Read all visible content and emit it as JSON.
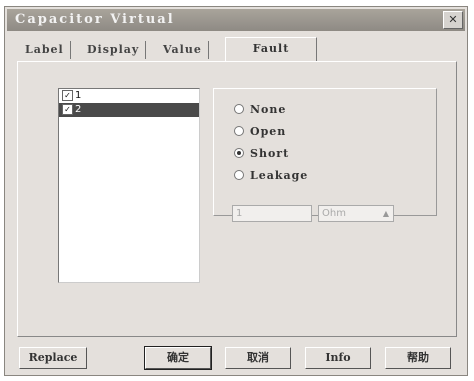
{
  "window": {
    "title": "Capacitor Virtual",
    "close_label": "✕"
  },
  "tabs": [
    {
      "label": "Label"
    },
    {
      "label": "Display"
    },
    {
      "label": "Value"
    },
    {
      "label": "Fault"
    }
  ],
  "fault_list": {
    "items": [
      {
        "label": "1",
        "checked": true,
        "selected": false
      },
      {
        "label": "2",
        "checked": true,
        "selected": true
      }
    ]
  },
  "fault_options": {
    "items": [
      {
        "label": "None",
        "selected": false
      },
      {
        "label": "Open",
        "selected": false
      },
      {
        "label": "Short",
        "selected": true
      },
      {
        "label": "Leakage",
        "selected": false
      }
    ],
    "leakage_value": "1",
    "leakage_unit": "Ohm"
  },
  "buttons": {
    "replace": "Replace",
    "ok": "确定",
    "cancel": "取消",
    "info": "Info",
    "help": "帮助"
  }
}
